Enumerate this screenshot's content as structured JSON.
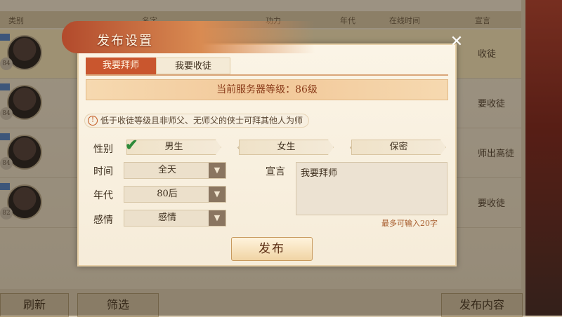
{
  "background": {
    "header": {
      "type": "类别",
      "name": "名字",
      "power": "功力",
      "era": "年代",
      "online": "在线时间",
      "declaration": "宣言"
    },
    "rows": [
      {
        "level": "84",
        "action": "收徒"
      },
      {
        "level": "84",
        "action": "要收徒"
      },
      {
        "level": "84",
        "action": "师出高徒"
      },
      {
        "level": "82",
        "action": "要收徒"
      }
    ],
    "buttons": {
      "refresh": "刷新",
      "filter": "筛选",
      "publish_content": "发布内容"
    }
  },
  "dialog": {
    "title": "发布设置",
    "tabs": [
      "我要拜师",
      "我要收徒"
    ],
    "active_tab": "我要拜师",
    "server_level": "当前服务器等级：86级",
    "note": "低于收徒等级且非师父、无师父的侠士可拜其他人为师",
    "gender_label": "性别",
    "gender_options": [
      "男生",
      "女生",
      "保密"
    ],
    "gender_selected": "男生",
    "time_label": "时间",
    "time_value": "全天",
    "era_label": "年代",
    "era_value": "80后",
    "emotion_label": "感情",
    "emotion_value": "感情",
    "declaration_label": "宣言",
    "declaration_value": "我要拜师",
    "limit_text": "最多可输入20字",
    "publish_label": "发布"
  },
  "colors": {
    "accent": "#c9562e",
    "check": "#2e8a3a"
  }
}
